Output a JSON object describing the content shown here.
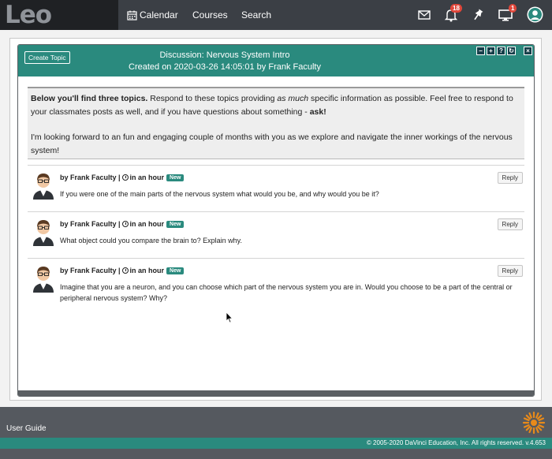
{
  "app": {
    "logo_text": "Leo"
  },
  "nav": {
    "calendar": "Calendar",
    "courses": "Courses",
    "search": "Search"
  },
  "toolbar": {
    "notifications_count": "18",
    "monitor_count": "1"
  },
  "dialog": {
    "create_topic": "Create Topic",
    "title": "Discussion: Nervous System Intro",
    "created": "Created on 2020-03-26 14:05:01 by Frank Faculty",
    "controls": [
      "−",
      "+",
      "?",
      "↻",
      "×"
    ]
  },
  "intro": {
    "p1_bold": "Below you'll find three topics.",
    "p1_a": " Respond to these topics providing ",
    "p1_italic": "as much",
    "p1_b": " specific information as possible. Feel free to respond to your classmates posts as well, and if you have questions about something - ",
    "p1_bold2": "ask!",
    "p2": "I'm looking forward to an fun and engaging couple of months with you as we explore and navigate the inner workings of the nervous system!"
  },
  "posts": [
    {
      "author": "by Frank Faculty |",
      "time": "in an hour",
      "badge": "New",
      "text": "If you were one of the main parts of the nervous system what would you be, and why would you be it?",
      "reply": "Reply"
    },
    {
      "author": "by Frank Faculty |",
      "time": "in an hour",
      "badge": "New",
      "text": "What object could you compare the brain to? Explain why.",
      "reply": "Reply"
    },
    {
      "author": "by Frank Faculty |",
      "time": "in an hour",
      "badge": "New",
      "text": "Imagine that you are a neuron, and you can choose which part of the nervous system you are in. Would you choose to be a part of the central or peripheral nervous system? Why?",
      "reply": "Reply"
    }
  ],
  "footer": {
    "user_guide": "User Guide",
    "copyright": "© 2005-2020 DaVinci Education, Inc. All rights reserved. v.4.653"
  },
  "colors": {
    "teal": "#2a8a7e",
    "nav_dark": "#3b3f45",
    "badge_red": "#e0463a"
  },
  "icons": [
    "calendar-icon",
    "mail-icon",
    "bell-icon",
    "pin-icon",
    "monitor-icon",
    "user-icon",
    "clock-icon",
    "avatar-icon",
    "sun-logo-icon",
    "cursor-icon"
  ]
}
